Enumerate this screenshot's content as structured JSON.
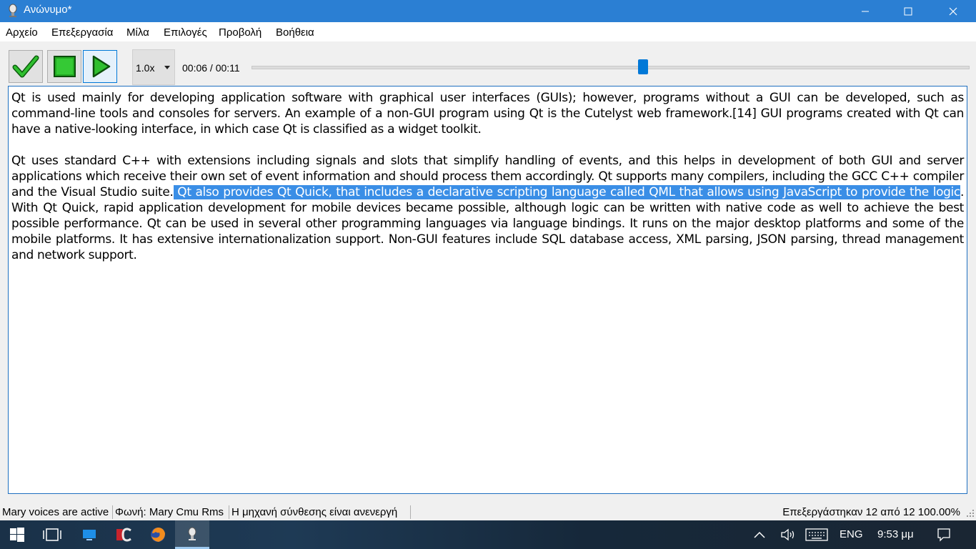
{
  "window": {
    "title": "Ανώνυμο*",
    "icons": {
      "app": "microphone-app-icon",
      "minimize": "minimize-icon",
      "maximize": "maximize-icon",
      "close": "close-icon"
    }
  },
  "menu": {
    "file": "Αρχείο",
    "edit": "Επεξεργασία",
    "speak": "Μίλα",
    "options": "Επιλογές",
    "view": "Προβολή",
    "help": "Βοήθεια"
  },
  "toolbar": {
    "icons": {
      "check": "checkmark-icon",
      "stop": "stop-icon",
      "play": "play-icon"
    },
    "speed": "1.0x",
    "time": "00:06 / 00:11",
    "progress": 0.545
  },
  "editor": {
    "para1": "Qt is used mainly for developing application software with graphical user interfaces (GUIs); however, programs without a GUI can be developed, such as command-line tools and consoles for servers. An example of a non-GUI program using Qt is the Cutelyst web framework.[14] GUI programs created with Qt can have a native-looking interface, in which case Qt is classified as a widget toolkit.",
    "para2_before": "Qt uses standard C++ with extensions including signals and slots that simplify handling of events, and this helps in development of both GUI and server applications which receive their own set of event information and should process them accordingly. Qt supports many compilers, including the GCC C++ compiler and the Visual Studio suite.",
    "para2_selected": " Qt also provides Qt Quick, that includes a declarative scripting language called QML that allows using JavaScript to provide the logic",
    "para2_after": ". With Qt Quick, rapid application development for mobile devices became possible, although logic can be written with native code as well to achieve the best possible performance. Qt can be used in several other programming languages via language bindings. It runs on the major desktop platforms and some of the mobile platforms. It has extensive internationalization support. Non-GUI features include SQL database access, XML parsing, JSON parsing, thread management and network support."
  },
  "status": {
    "voices": "Mary voices are active",
    "voice": "Φωνή: Mary Cmu Rms",
    "engine": "Η μηχανή σύνθεσης είναι ανενεργή",
    "progress": "Επεξεργάστηκαν 12 από 12 100.00%"
  },
  "taskbar": {
    "icons": {
      "start": "windows-start-icon",
      "taskview": "task-view-icon",
      "desktop": "desktop-app-icon",
      "dc": "dc-app-icon",
      "firefox": "firefox-icon",
      "app": "microphone-app-icon",
      "chevron": "chevron-up-icon",
      "volume": "volume-icon",
      "keyboard": "keyboard-icon",
      "notifications": "notifications-icon"
    },
    "lang": "ENG",
    "clock": "9:53 μμ"
  }
}
